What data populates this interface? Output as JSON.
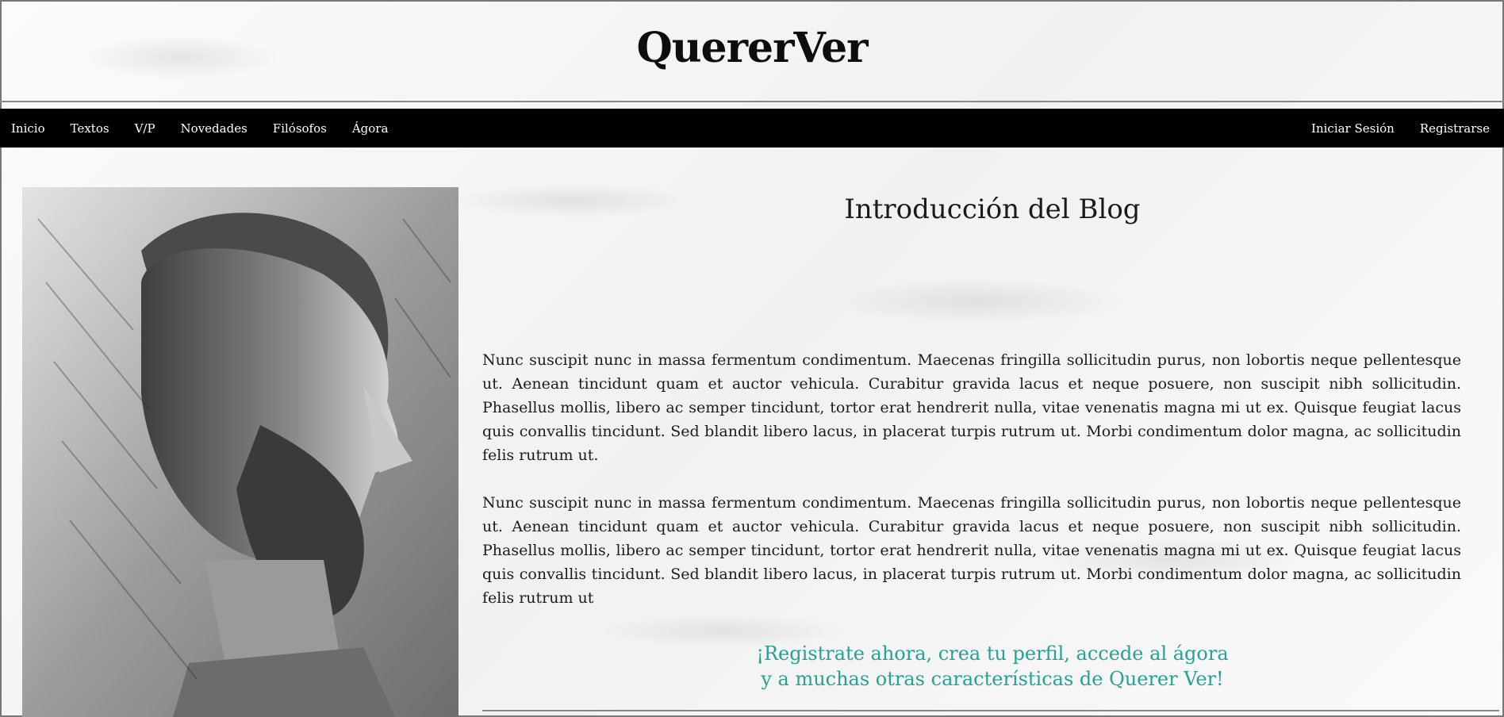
{
  "site": {
    "title": "QuererVer"
  },
  "nav": {
    "left": [
      {
        "label": "Inicio"
      },
      {
        "label": "Textos"
      },
      {
        "label": "V/P"
      },
      {
        "label": "Novedades"
      },
      {
        "label": "Filósofos"
      },
      {
        "label": "Ágora"
      }
    ],
    "right": [
      {
        "label": "Iniciar Sesión"
      },
      {
        "label": "Registrarse"
      }
    ]
  },
  "main": {
    "image": {
      "icon": "philosopher-bust-drawing"
    },
    "title": "Introducción del Blog",
    "paragraphs": [
      "Nunc suscipit nunc in massa fermentum condimentum. Maecenas fringilla sollicitudin purus, non lobortis neque pellentesque ut. Aenean tincidunt quam et auctor vehicula. Curabitur gravida lacus et neque posuere, non suscipit nibh sollicitudin. Phasellus mollis, libero ac semper tincidunt, tortor erat hendrerit nulla, vitae venenatis magna mi ut ex. Quisque feugiat lacus quis convallis tincidunt. Sed blandit libero lacus, in placerat turpis rutrum ut. Morbi condimentum dolor magna, ac sollicitudin felis rutrum ut.",
      "Nunc suscipit nunc in massa fermentum condimentum. Maecenas fringilla sollicitudin purus, non lobortis neque pellentesque ut. Aenean tincidunt quam et auctor vehicula. Curabitur gravida lacus et neque posuere, non suscipit nibh sollicitudin. Phasellus mollis, libero ac semper tincidunt, tortor erat hendrerit nulla, vitae venenatis magna mi ut ex. Quisque feugiat lacus quis convallis tincidunt. Sed blandit libero lacus, in placerat turpis rutrum ut. Morbi condimentum dolor magna, ac sollicitudin felis rutrum ut"
    ],
    "cta": {
      "line1": "¡Registrate ahora, crea tu perfil, accede al ágora",
      "line2": "y a muchas otras características de Querer Ver!"
    }
  },
  "colors": {
    "nav_bg": "#000000",
    "nav_text": "#ffffff",
    "cta": "#27a193"
  }
}
